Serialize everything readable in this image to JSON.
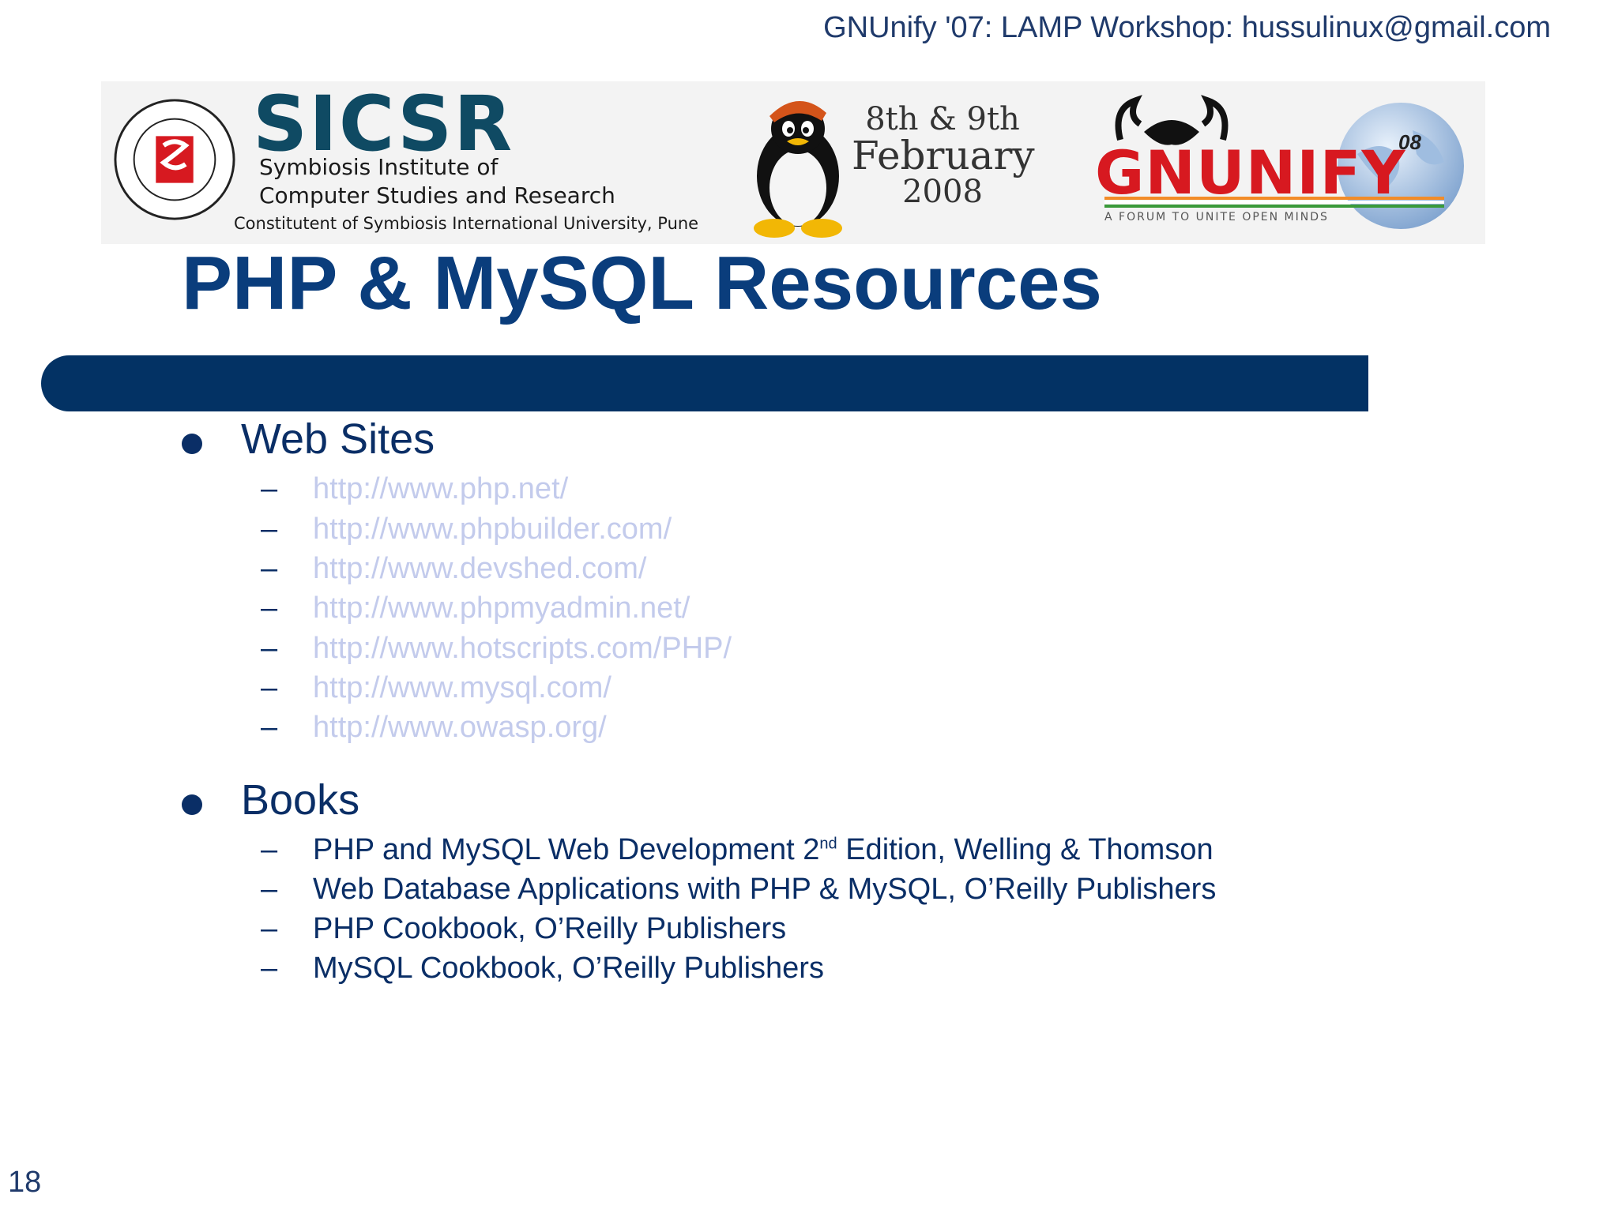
{
  "header": {
    "text": "GNUnify '07: LAMP Workshop: hussulinux@gmail.com"
  },
  "banner": {
    "sicsr_name": "SICSR",
    "sicsr_line1": "Symbiosis Institute of",
    "sicsr_line2": "Computer Studies and Research",
    "sicsr_line3": "Constitutent of Symbiosis International University, Pune",
    "date_line1": "8th & 9th",
    "date_line2": "February",
    "date_line3": "2008",
    "gnunify_name": "GNUNIFY",
    "gnunify_tagline": "A FORUM TO UNITE OPEN MINDS",
    "globe_number": "08"
  },
  "slide": {
    "title": "PHP & MySQL Resources",
    "sections": [
      {
        "heading": "Web Sites",
        "items": [
          "http://www.php.net/",
          "http://www.phpbuilder.com/",
          "http://www.devshed.com/",
          "http://www.phpmyadmin.net/",
          "http://www.hotscripts.com/PHP/",
          "http://www.mysql.com/",
          "http://www.owasp.org/"
        ]
      },
      {
        "heading": "Books",
        "items": [
          {
            "before": "PHP and MySQL Web Development 2",
            "sup": "nd",
            "after": " Edition, Welling & Thomson"
          },
          "Web Database Applications with PHP & MySQL, O’Reilly Publishers",
          "PHP Cookbook, O’Reilly Publishers",
          "MySQL Cookbook, O’Reilly Publishers"
        ]
      }
    ],
    "dash": "–"
  },
  "footer": {
    "page_number": "18"
  },
  "colors": {
    "title": "#0a3d7c",
    "bar": "#033264",
    "text": "#0a2e66",
    "link": "#c3cbec"
  }
}
